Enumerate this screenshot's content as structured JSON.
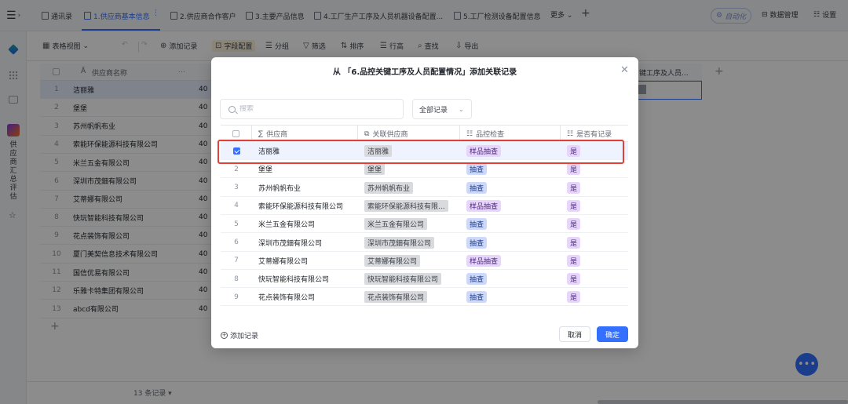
{
  "tabbar": {
    "menu_icon": "hamburger-icon",
    "tabs": [
      {
        "label": "通讯录",
        "active": false
      },
      {
        "label": "1.供应商基本信息",
        "active": true
      },
      {
        "label": "2.供应商合作客户",
        "active": false
      },
      {
        "label": "3.主要产品信息",
        "active": false
      },
      {
        "label": "4.工厂生产工序及人员机器设备配置...",
        "active": false
      },
      {
        "label": "5.工厂检测设备配置信息",
        "active": false
      }
    ],
    "more_label": "更多",
    "automation_label": "自动化",
    "data_manage_label": "数据管理",
    "settings_label": "设置"
  },
  "rail": {
    "app_name_vertical": "供应商汇总评估"
  },
  "toolbar": {
    "view_label": "表格视图",
    "add_record_label": "添加记录",
    "field_config_label": "字段配置",
    "group_label": "分组",
    "filter_label": "筛选",
    "sort_label": "排序",
    "row_height_label": "行高",
    "find_label": "查找",
    "export_label": "导出"
  },
  "background_table": {
    "name_header": "供应商名称",
    "col_header_extra": "键工序及人员...",
    "rows": [
      {
        "num": "1",
        "name": "洁丽雅",
        "v": "40"
      },
      {
        "num": "2",
        "name": "堡堡",
        "v": "40"
      },
      {
        "num": "3",
        "name": "苏州帆帆布业",
        "v": "40"
      },
      {
        "num": "4",
        "name": "索能环保能源科技有限公司",
        "v": "40"
      },
      {
        "num": "5",
        "name": "米兰五金有限公司",
        "v": "40"
      },
      {
        "num": "6",
        "name": "深圳市茂鈿有限公司",
        "v": "40"
      },
      {
        "num": "7",
        "name": "艾蒂娜有限公司",
        "v": "40"
      },
      {
        "num": "8",
        "name": "快玩智能科技有限公司",
        "v": "40"
      },
      {
        "num": "9",
        "name": "花点装饰有限公司",
        "v": "40"
      },
      {
        "num": "10",
        "name": "厦门美契信息技术有限公司",
        "v": "40"
      },
      {
        "num": "11",
        "name": "国信优易有限公司",
        "v": "40"
      },
      {
        "num": "12",
        "name": "乐雅卡特集团有限公司",
        "v": "40"
      },
      {
        "num": "13",
        "name": "abcd有限公司",
        "v": "40"
      }
    ],
    "record_count": "13 条记录 ▾"
  },
  "modal": {
    "title": "从 「6.品控关键工序及人员配置情况」添加关联记录",
    "search_placeholder": "搜索",
    "filter_value": "全部记录",
    "columns": [
      "供应商",
      "关联供应商",
      "品控检查",
      "是否有记录"
    ],
    "rows": [
      {
        "num": "",
        "supplier": "洁丽雅",
        "linked": "洁丽雅",
        "qc": "样品抽查",
        "has": "是",
        "checked": true
      },
      {
        "num": "2",
        "supplier": "堡堡",
        "linked": "堡堡",
        "qc": "抽查",
        "has": "是",
        "checked": false
      },
      {
        "num": "3",
        "supplier": "苏州帆帆布业",
        "linked": "苏州帆帆布业",
        "qc": "抽查",
        "has": "是",
        "checked": false
      },
      {
        "num": "4",
        "supplier": "索能环保能源科技有限公司",
        "linked": "索能环保能源科技有限...",
        "qc": "样品抽查",
        "has": "是",
        "checked": false
      },
      {
        "num": "5",
        "supplier": "米兰五金有限公司",
        "linked": "米兰五金有限公司",
        "qc": "抽查",
        "has": "是",
        "checked": false
      },
      {
        "num": "6",
        "supplier": "深圳市茂鈿有限公司",
        "linked": "深圳市茂鈿有限公司",
        "qc": "抽查",
        "has": "是",
        "checked": false
      },
      {
        "num": "7",
        "supplier": "艾蒂娜有限公司",
        "linked": "艾蒂娜有限公司",
        "qc": "样品抽查",
        "has": "是",
        "checked": false
      },
      {
        "num": "8",
        "supplier": "快玩智能科技有限公司",
        "linked": "快玩智能科技有限公司",
        "qc": "抽查",
        "has": "是",
        "checked": false
      },
      {
        "num": "9",
        "supplier": "花点装饰有限公司",
        "linked": "花点装饰有限公司",
        "qc": "抽查",
        "has": "是",
        "checked": false
      }
    ],
    "add_record_label": "添加记录",
    "cancel_label": "取消",
    "confirm_label": "确定"
  },
  "colors": {
    "accent": "#3370ff",
    "highlight_border": "#e0403a",
    "chip_blue": "#cdd9fb",
    "chip_purple": "#e7d5fb"
  }
}
